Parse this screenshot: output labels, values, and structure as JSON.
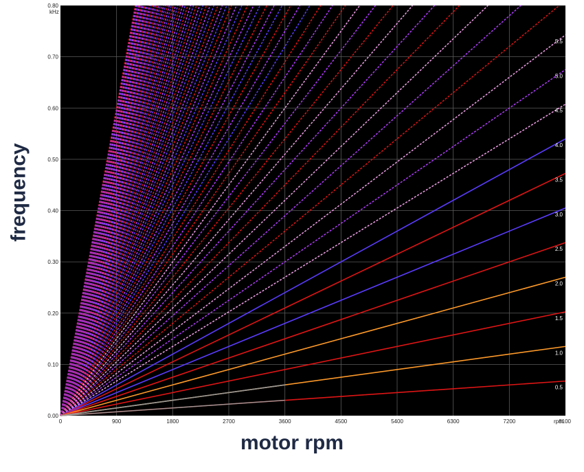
{
  "chart_data": {
    "type": "line",
    "title": "",
    "xlabel": "motor rpm",
    "ylabel": "frequency",
    "y_unit": "kHz",
    "x_unit": "rpm",
    "xlim": [
      0,
      8100
    ],
    "ylim": [
      0,
      0.8
    ],
    "x_ticks": [
      "0",
      "900",
      "1800",
      "2700",
      "3600",
      "4500",
      "5400",
      "6300",
      "7200",
      "8100"
    ],
    "y_ticks": [
      "0.00",
      "0.10",
      "0.20",
      "0.30",
      "0.40",
      "0.50",
      "0.60",
      "0.70",
      "0.80"
    ],
    "grid": true,
    "background": "#000000",
    "order_labels": [
      "0.5",
      "1.0",
      "1.5",
      "2.0",
      "2.5",
      "3.0",
      "3.5",
      "4.0",
      "4.5",
      "5.0",
      "5.5"
    ],
    "order_label_x_rpm": 8100,
    "order_step": 0.5,
    "max_order": 40,
    "colors": {
      "red": "#e01515",
      "orange": "#ff9a2a",
      "blue": "#5a3cff",
      "violet": "#b23cff",
      "pink": "#f0a0e8",
      "grey": "#9a9a9a"
    }
  }
}
